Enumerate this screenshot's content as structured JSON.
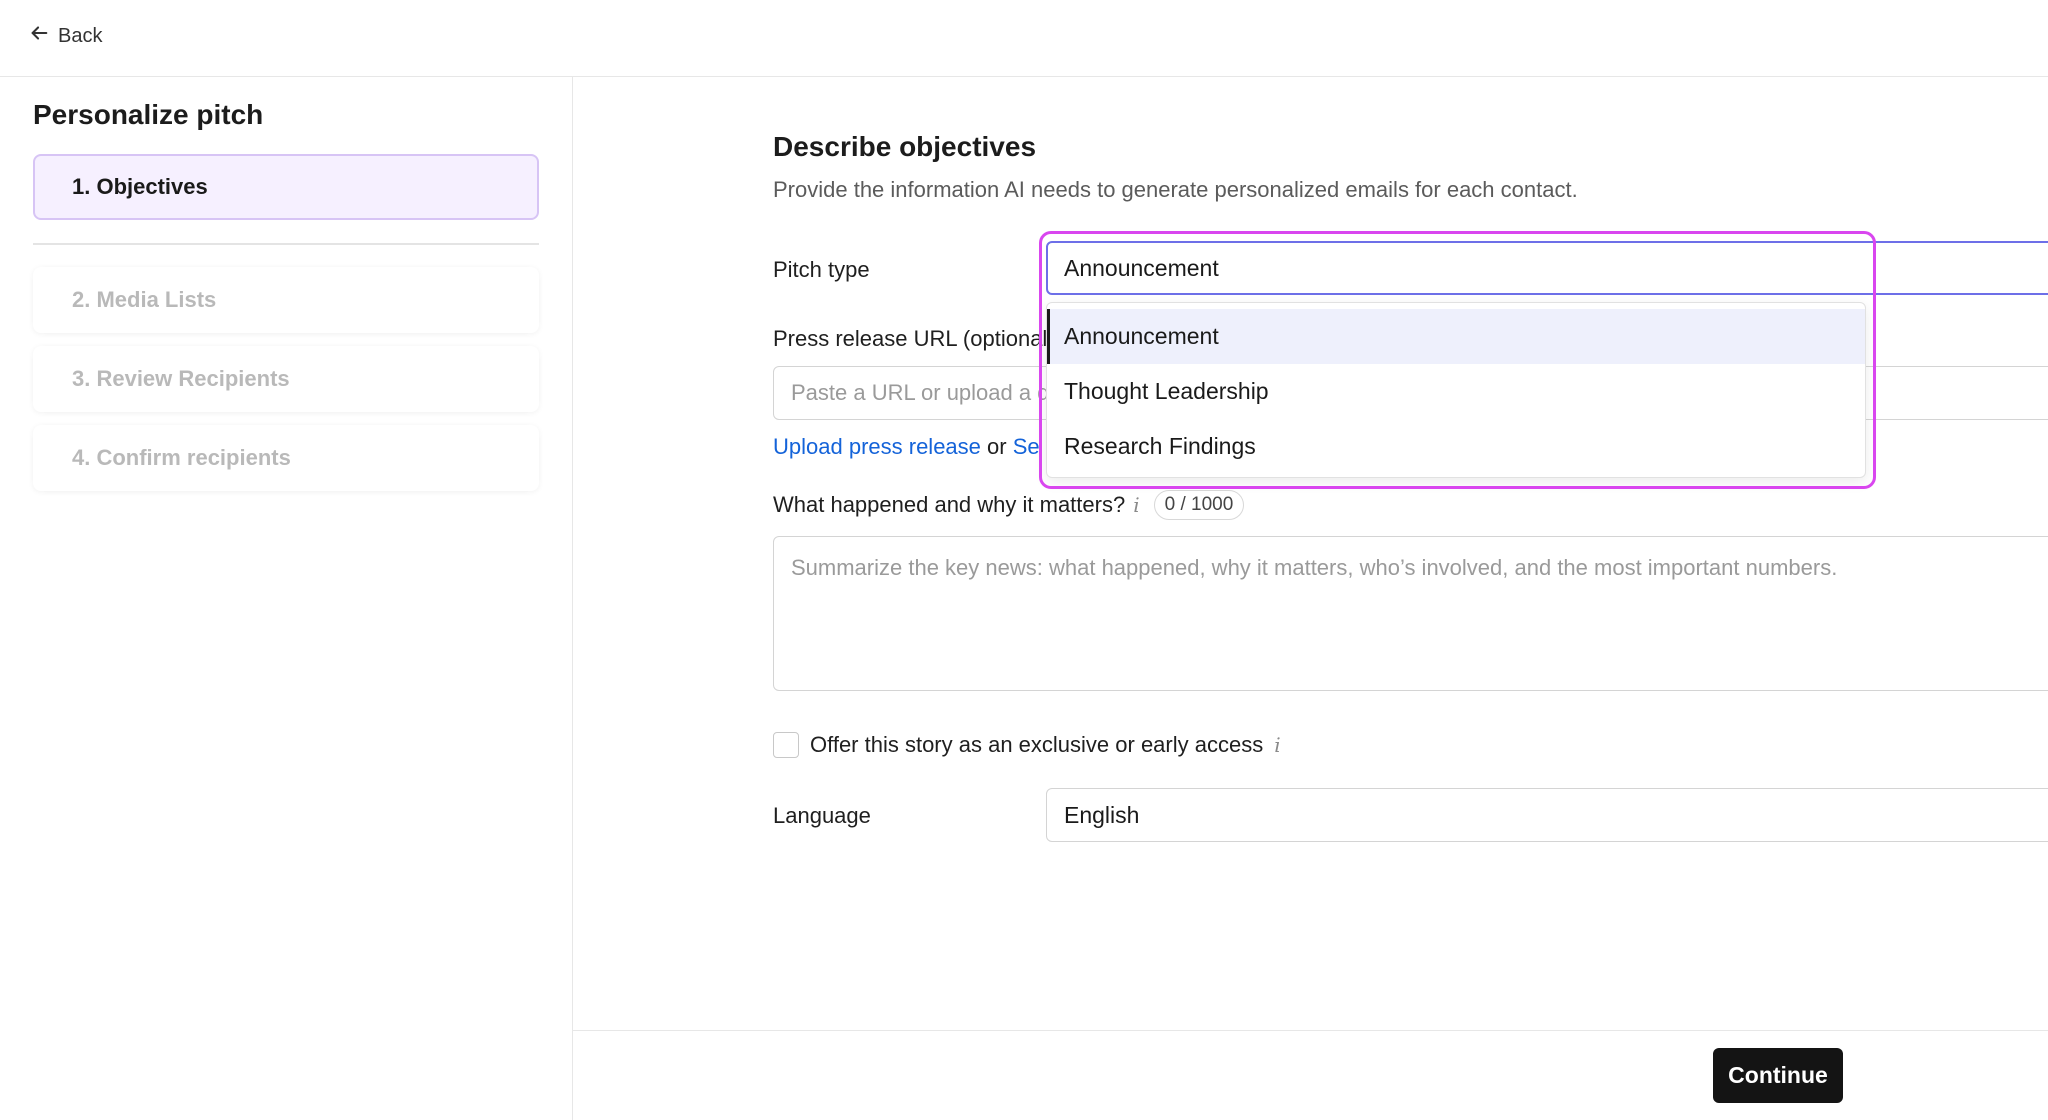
{
  "topbar": {
    "back_label": "Back"
  },
  "sidebar": {
    "title": "Personalize pitch",
    "steps": [
      {
        "label": "1. Objectives",
        "state": "active"
      },
      {
        "label": "2. Media Lists",
        "state": "inactive"
      },
      {
        "label": "3. Review Recipients",
        "state": "inactive"
      },
      {
        "label": "4. Confirm recipients",
        "state": "inactive"
      }
    ]
  },
  "main": {
    "title": "Describe objectives",
    "subtitle": "Provide the information AI needs to generate personalized emails for each contact.",
    "pitch_type": {
      "label": "Pitch type",
      "value": "Announcement",
      "options": [
        "Announcement",
        "Thought Leadership",
        "Research Findings"
      ],
      "selected_index": 0,
      "open": true
    },
    "press_release": {
      "label": "Press release URL (optional)",
      "placeholder": "Paste a URL or upload a document",
      "upload_link": "Upload press release",
      "or_text": "or",
      "second_link": "Se"
    },
    "what_happened": {
      "label": "What happened and why it matters?",
      "info_icon": "i",
      "counter": "0 / 1000",
      "placeholder": "Summarize the key news: what happened, why it matters, who’s involved, and the most important numbers."
    },
    "exclusive": {
      "label": "Offer this story as an exclusive or early access",
      "info_icon": "i",
      "checked": false
    },
    "language": {
      "label": "Language",
      "value": "English"
    }
  },
  "footer": {
    "continue_label": "Continue"
  },
  "colors": {
    "accent_highlight": "#d946ef",
    "link": "#1463d9",
    "active_step_bg": "#f6f0ff",
    "primary_button": "#141414"
  }
}
